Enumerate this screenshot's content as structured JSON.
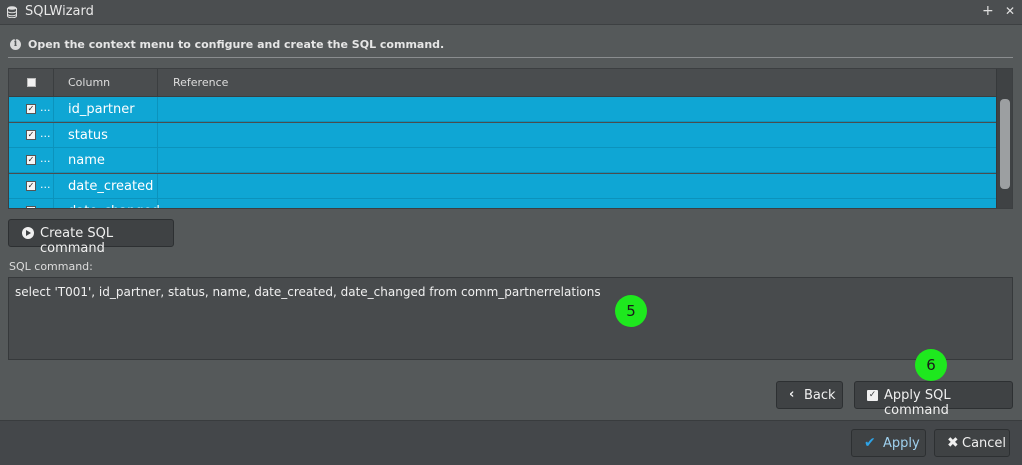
{
  "window": {
    "title": "SQLWizard",
    "add_glyph": "+",
    "close_glyph": "✕"
  },
  "info": {
    "icon": "i",
    "text": "Open the context menu to configure and create the SQL command."
  },
  "grid": {
    "headers": {
      "column": "Column",
      "reference": "Reference"
    },
    "rows": [
      {
        "checked": true,
        "dots": "...",
        "column": "id_partner",
        "reference": ""
      },
      {
        "checked": true,
        "dots": "...",
        "column": "status",
        "reference": ""
      },
      {
        "checked": true,
        "dots": "...",
        "column": "name",
        "reference": ""
      },
      {
        "checked": true,
        "dots": "...",
        "column": "date_created",
        "reference": ""
      },
      {
        "checked": true,
        "dots": "...",
        "column": "date_changed",
        "reference": ""
      }
    ]
  },
  "buttons": {
    "create_sql": "Create SQL command",
    "back": "Back",
    "apply_sql": "Apply SQL command",
    "apply": "Apply",
    "cancel": "Cancel"
  },
  "sql": {
    "label": "SQL command:",
    "value": "select 'T001', id_partner, status, name, date_created, date_changed from comm_partnerrelations"
  },
  "markers": {
    "m5": "5",
    "m6": "6"
  },
  "colors": {
    "row_selected": "#0fa6d4",
    "marker": "#1ee81e",
    "apply_check": "#2ea3e6"
  },
  "icons": [
    "database-icon",
    "info-icon",
    "play-icon",
    "chevron-left-icon",
    "checkbox-icon",
    "check-icon",
    "close-icon",
    "plus-icon"
  ]
}
